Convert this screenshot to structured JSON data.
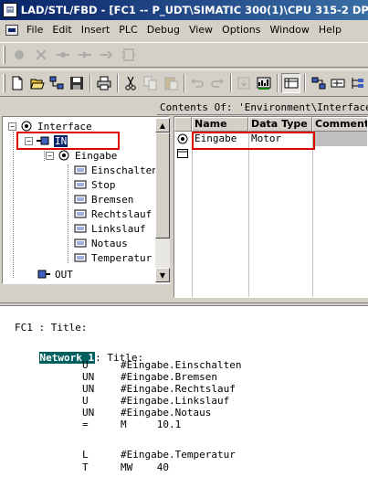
{
  "window": {
    "title": "LAD/STL/FBD  - [FC1 -- P_UDT\\SIMATIC 300(1)\\CPU 315-2 DP]"
  },
  "menu": [
    "File",
    "Edit",
    "Insert",
    "PLC",
    "Debug",
    "View",
    "Options",
    "Window",
    "Help"
  ],
  "toolbar1": {
    "icons": [
      "insert-network-icon",
      "unplug-icon",
      "branch-icon",
      "close-branch-icon",
      "connection-icon",
      "box-icon"
    ]
  },
  "toolbar2": {
    "icons": [
      "new-icon",
      "open-icon",
      "accessible-nodes-icon",
      "save-icon",
      "print-icon",
      "cut-icon",
      "copy-icon",
      "paste-icon",
      "undo-icon",
      "redo-icon",
      "download-icon",
      "monitor-icon",
      "overview-icon",
      "details-icon",
      "program-elements-icon",
      "call-structure-icon"
    ]
  },
  "interface_panel": {
    "header": "Contents Of: 'Environment\\Interface",
    "tree": {
      "root": "Interface",
      "in_label": "IN",
      "struct_label": "Eingabe",
      "fields": [
        "Einschalten",
        "Stop",
        "Bremsen",
        "Rechtslauf",
        "Linkslauf",
        "Notaus",
        "Temperatur"
      ],
      "out_label": "OUT"
    },
    "table": {
      "columns": [
        "Name",
        "Data Type",
        "Comment"
      ],
      "rows": [
        {
          "name": "Eingabe",
          "type": "Motor",
          "comment": ""
        }
      ]
    }
  },
  "code": {
    "block_title": "FC1 : Title:",
    "network_label": "Network 1",
    "network_title": ": Title:",
    "lines": [
      {
        "op": "U",
        "operand": "#Eingabe.Einschalten"
      },
      {
        "op": "UN",
        "operand": "#Eingabe.Bremsen"
      },
      {
        "op": "UN",
        "operand": "#Eingabe.Rechtslauf"
      },
      {
        "op": "U",
        "operand": "#Eingabe.Linkslauf"
      },
      {
        "op": "UN",
        "operand": "#Eingabe.Notaus"
      },
      {
        "op": "=",
        "operand": "M     10.1"
      },
      {
        "op": "",
        "operand": ""
      },
      {
        "op": "L",
        "operand": "#Eingabe.Temperatur"
      },
      {
        "op": "T",
        "operand": "MW    40"
      }
    ]
  },
  "colors": {
    "titlebar": "#0a246a",
    "highlight": "#e00000",
    "network_badge": "#005f5f"
  }
}
